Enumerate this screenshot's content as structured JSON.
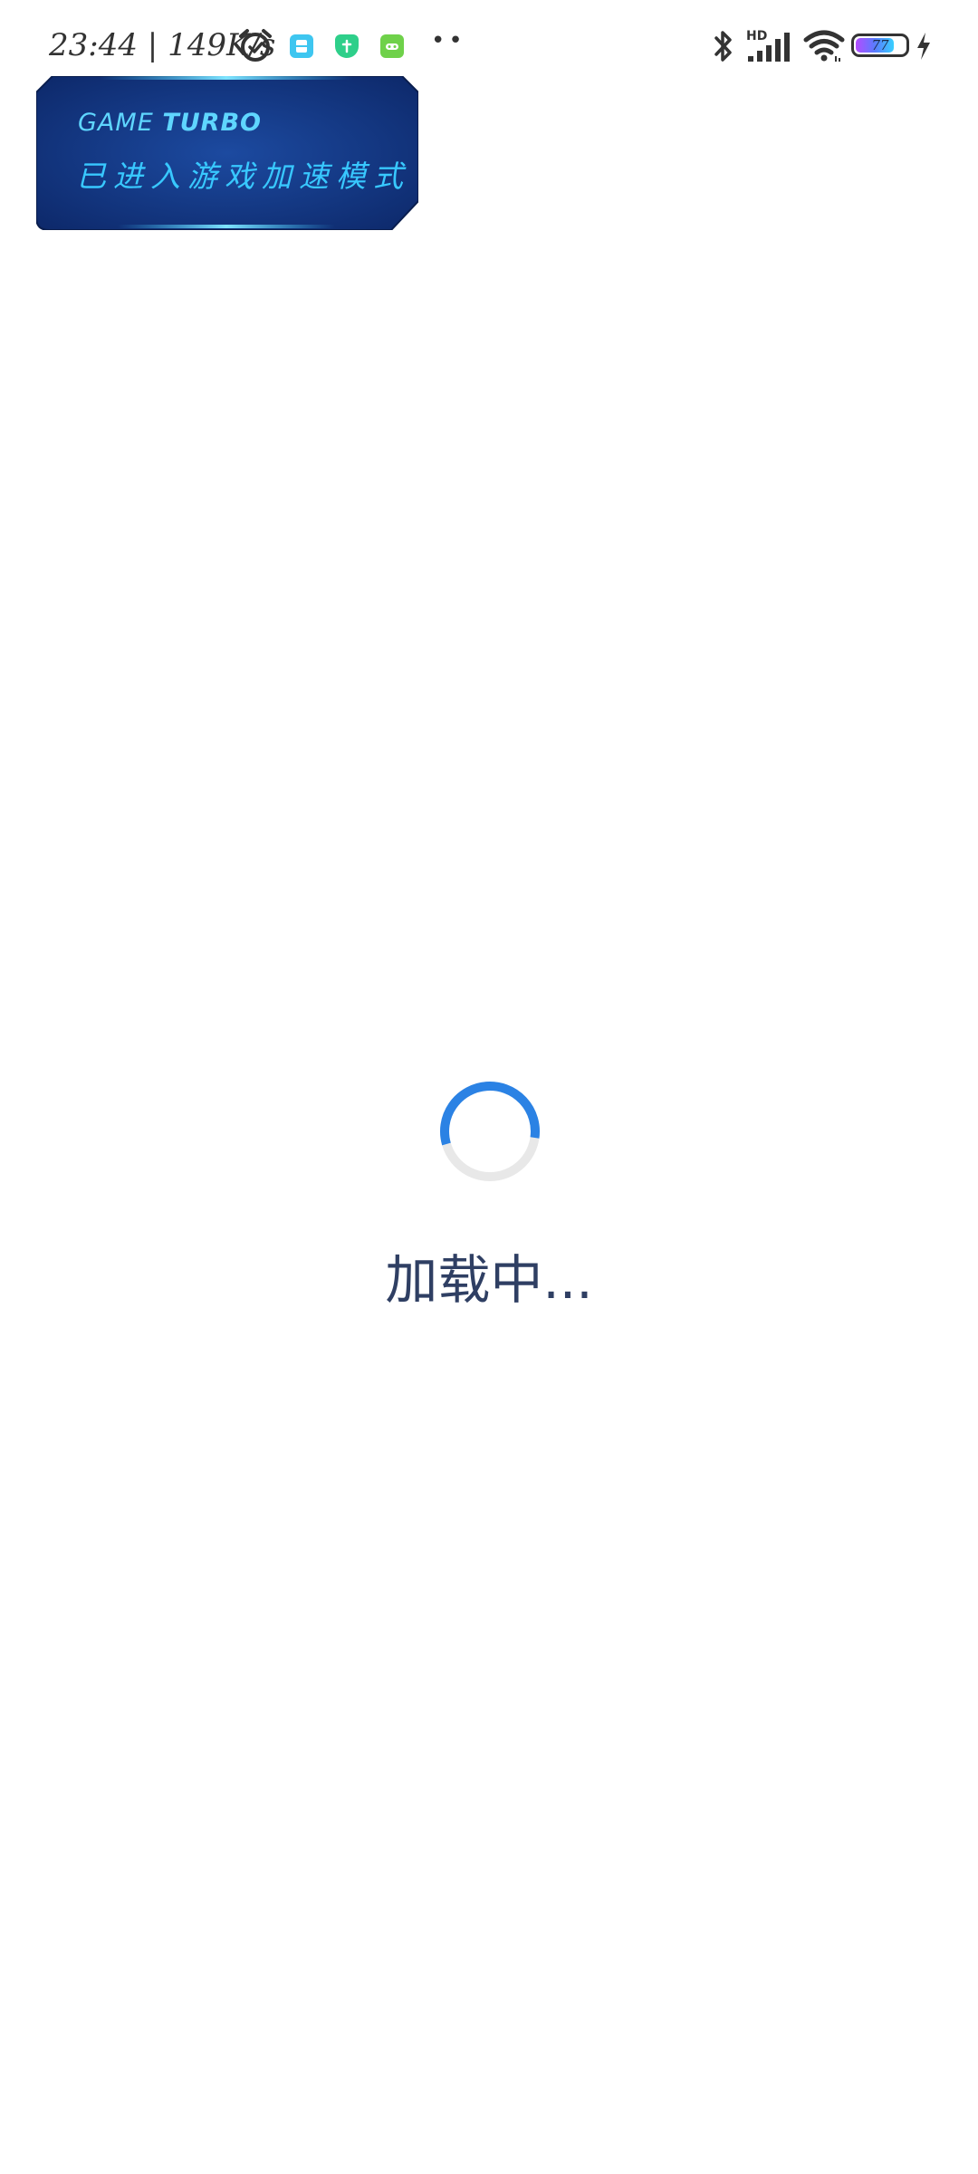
{
  "status_bar": {
    "time": "23:44",
    "network_speed": "149K/s",
    "battery_level": 77,
    "battery_label": "77",
    "signal_tag": "HD",
    "overflow": "••",
    "icons": [
      "alarm-icon",
      "app-notification-icon",
      "shield-app-icon",
      "gamepad-app-icon",
      "bluetooth-icon",
      "cellular-signal-icon",
      "wifi-icon",
      "battery-icon",
      "charging-icon"
    ],
    "app_colors": [
      "#3ec6f0",
      "#2ecf8a",
      "#6fd14a"
    ]
  },
  "turbo_banner": {
    "title_prefix": "GAME",
    "title_brand": "TURBO",
    "subtitle": "已进入游戏加速模式",
    "background": "#153a86",
    "accent": "#38c8ff"
  },
  "loading": {
    "text": "加载中...",
    "spinner_accent": "#2b82e4",
    "spinner_track": "#e8e8e8"
  }
}
